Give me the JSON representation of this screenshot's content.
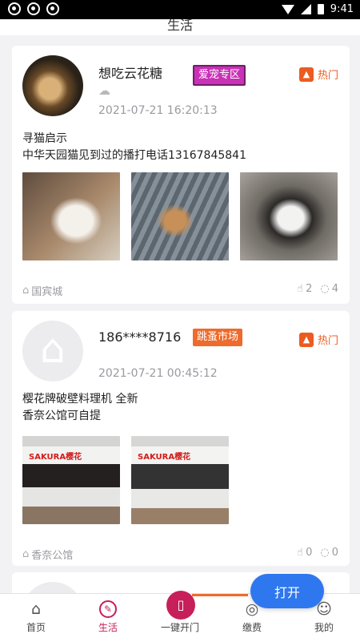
{
  "status_bar": {
    "time": "9:41"
  },
  "header": {
    "title": "生活"
  },
  "posts": [
    {
      "username": "想吃云花糖",
      "tag": "爱宠专区",
      "hot_label": "热门",
      "weather": "☁",
      "time": "2021-07-21 16:20:13",
      "text": "寻猫启示\n中华天园猫见到过的播打电话13167845841",
      "location": "国宾城",
      "likes": "2",
      "comments": "4"
    },
    {
      "username": "186****8716",
      "tag": "跳蚤市场",
      "hot_label": "热门",
      "time": "2021-07-21 00:45:12",
      "text": "樱花牌破壁料理机 全新\n香奈公馆可自提",
      "photo_brand": "SAKURA樱花",
      "location": "香奈公馆",
      "likes": "0",
      "comments": "0"
    }
  ],
  "floating_button": {
    "label": "打开"
  },
  "tabbar": {
    "tabs": [
      {
        "label": "首页",
        "icon": "home-icon"
      },
      {
        "label": "生活",
        "icon": "life-icon"
      },
      {
        "label": "一键开门",
        "icon": "door-icon"
      },
      {
        "label": "缴费",
        "icon": "payment-icon"
      },
      {
        "label": "我的",
        "icon": "profile-icon"
      }
    ],
    "active_color": "#c71f5a"
  }
}
